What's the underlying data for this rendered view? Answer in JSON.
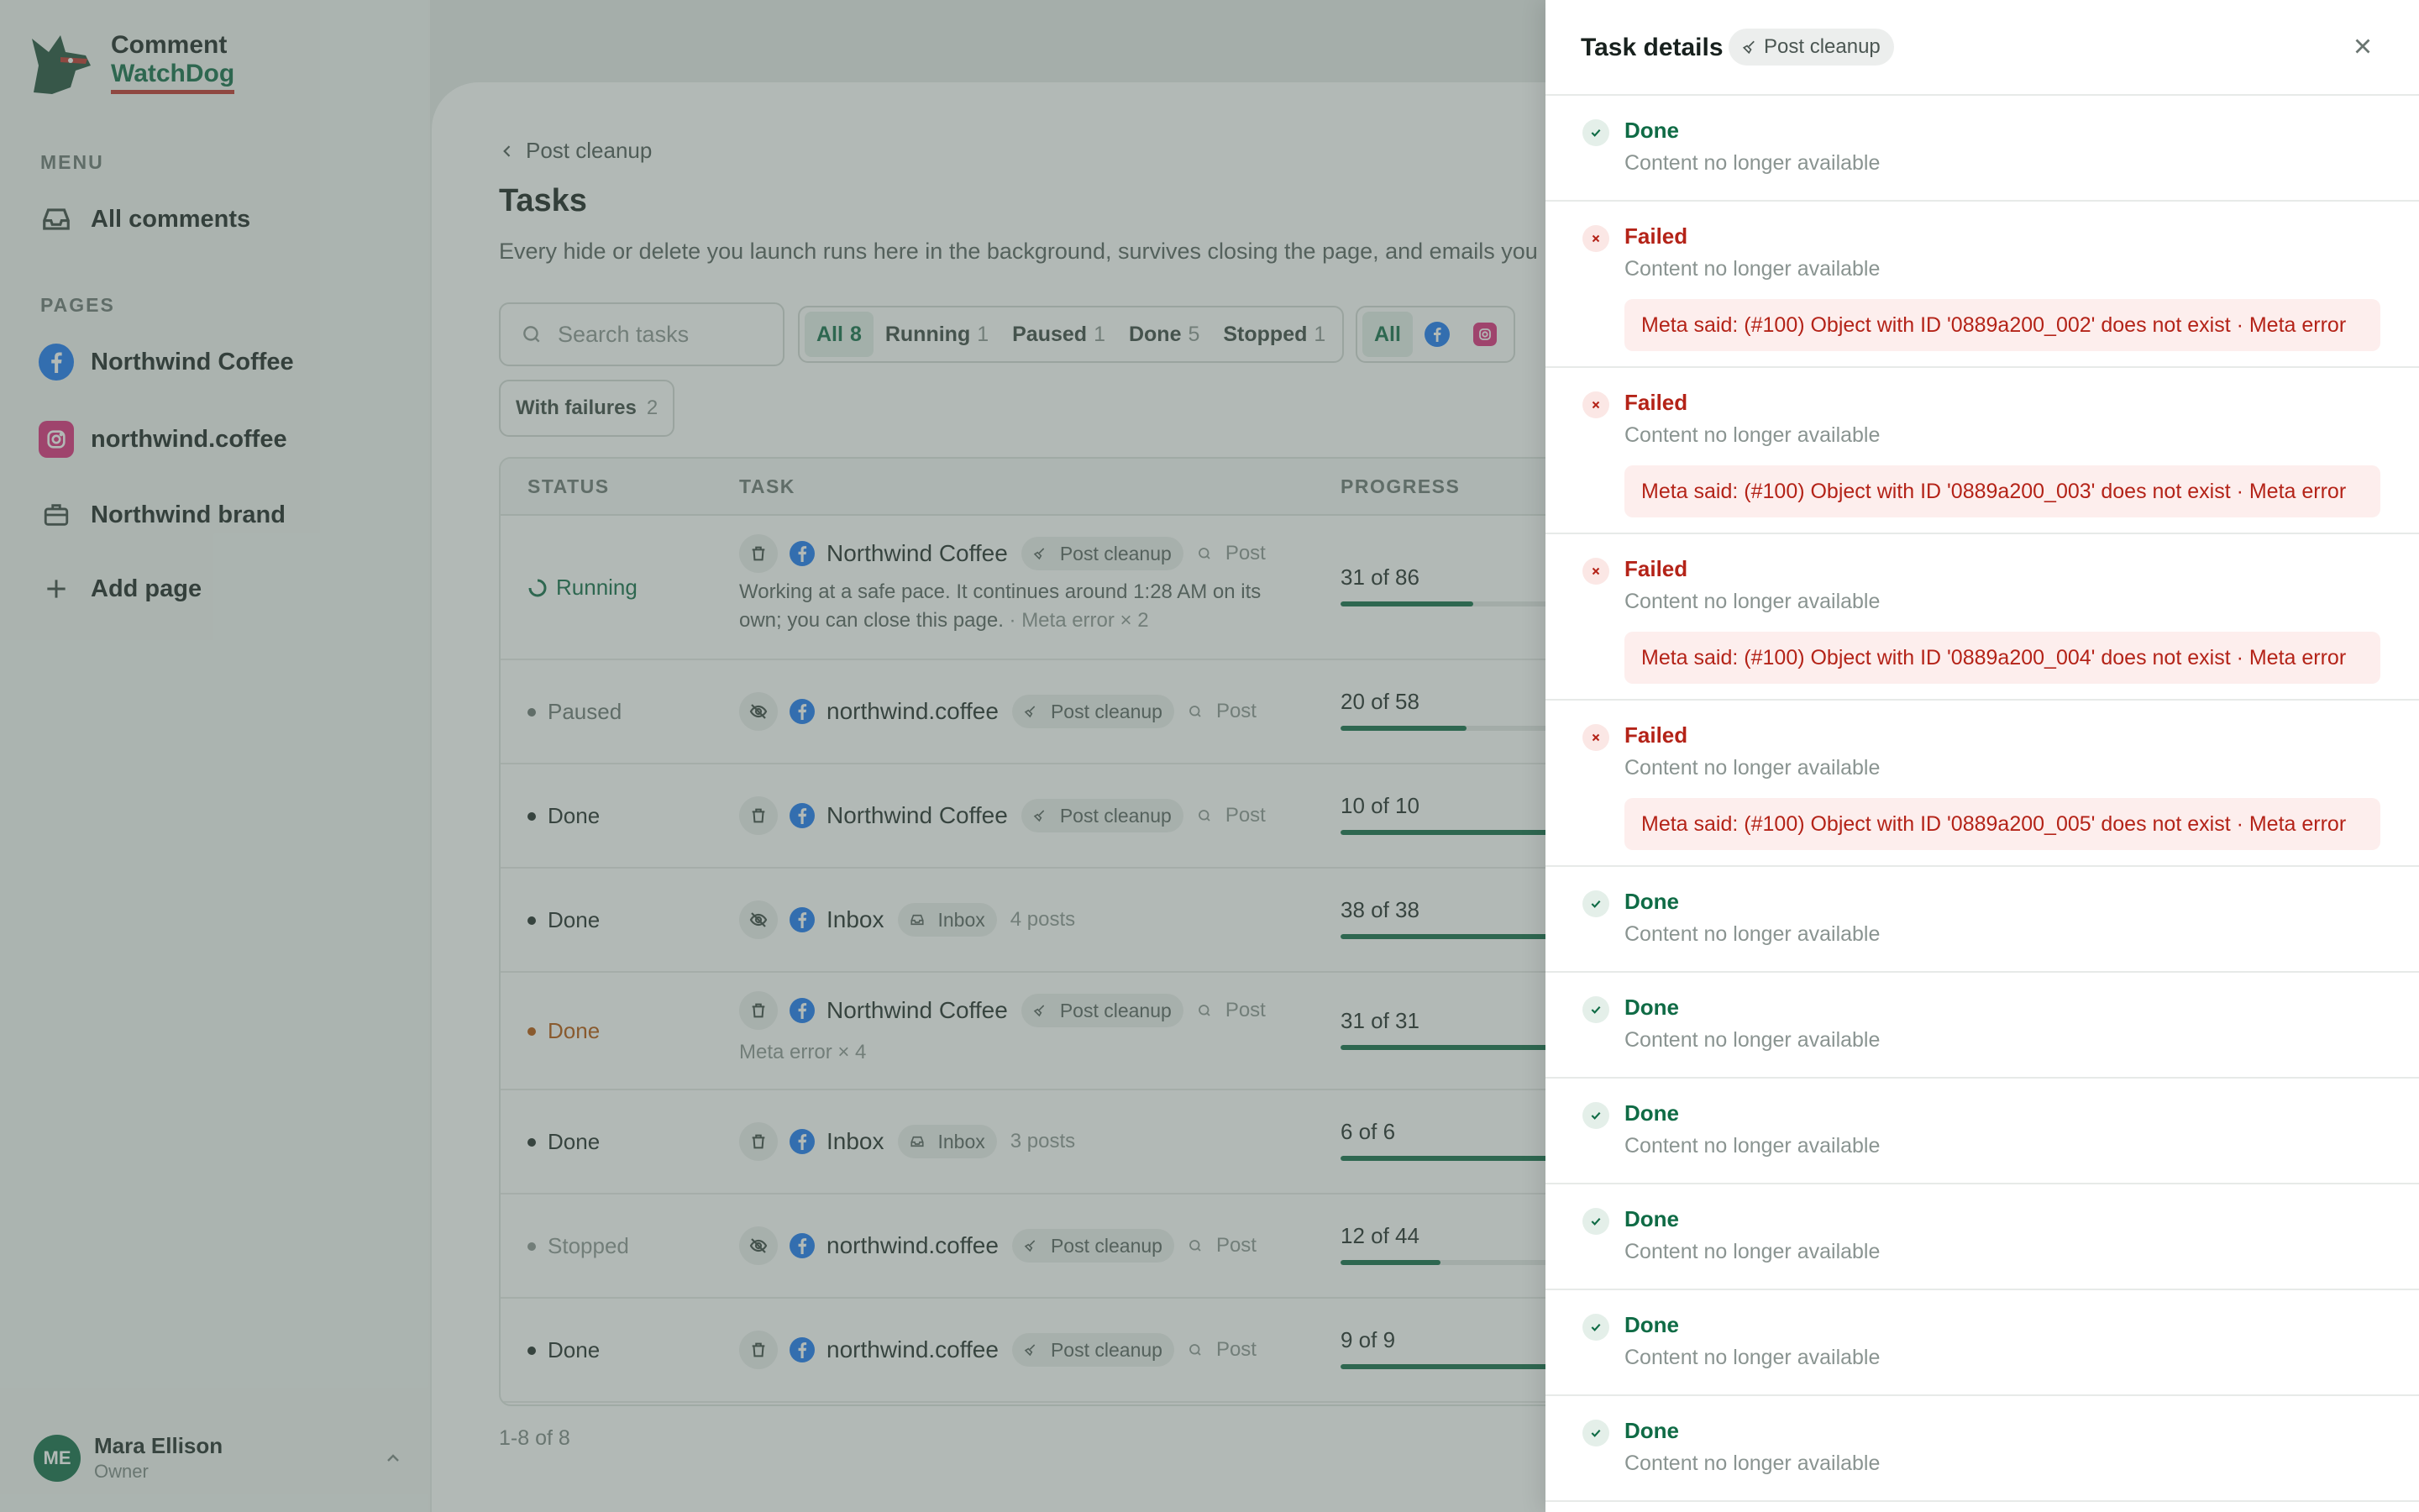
{
  "brand": {
    "line1": "Comment",
    "line2": "WatchDog"
  },
  "sidebar": {
    "menu_label": "MENU",
    "menu_items": [
      {
        "label": "All comments",
        "icon": "inbox-icon"
      }
    ],
    "pages_label": "PAGES",
    "pages": [
      {
        "label": "Northwind Coffee",
        "icon": "facebook-icon"
      },
      {
        "label": "northwind.coffee",
        "icon": "instagram-icon"
      },
      {
        "label": "Northwind brand",
        "icon": "briefcase-icon"
      }
    ],
    "add_page": "Add page",
    "user": {
      "initials": "ME",
      "name": "Mara Ellison",
      "role": "Owner"
    }
  },
  "main": {
    "back_label": "Post cleanup",
    "title": "Tasks",
    "subtitle": "Every hide or delete you launch runs here in the background, survives closing the page, and emails you",
    "search_placeholder": "Search tasks",
    "status_filters": [
      {
        "label": "All",
        "count": "8"
      },
      {
        "label": "Running",
        "count": "1"
      },
      {
        "label": "Paused",
        "count": "1"
      },
      {
        "label": "Done",
        "count": "5"
      },
      {
        "label": "Stopped",
        "count": "1"
      }
    ],
    "platform_filters": [
      {
        "label": "All"
      }
    ],
    "failures_filter": {
      "label": "With failures",
      "count": "2"
    },
    "columns": {
      "status": "STATUS",
      "task": "TASK",
      "progress": "PROGRESS"
    },
    "rows": [
      {
        "status": "Running",
        "status_color": "#0f6b45",
        "action": "delete",
        "page": "Northwind Coffee",
        "tag": "Post cleanup",
        "scope": "Post",
        "desc": "Working at a safe pace. It continues around 1:28 AM on its own; you can close this page.",
        "desc_muted": " · Meta error × 2",
        "progress": "31 of 86",
        "fraction": 0.36
      },
      {
        "status": "Paused",
        "status_color": "#6a7571",
        "action": "hide",
        "page": "northwind.coffee",
        "tag": "Post cleanup",
        "scope": "Post",
        "progress": "20 of 58",
        "fraction": 0.34
      },
      {
        "status": "Done",
        "status_color": "#1f2a27",
        "action": "delete",
        "page": "Northwind Coffee",
        "tag": "Post cleanup",
        "scope": "Post",
        "progress": "10 of 10",
        "fraction": 1.0
      },
      {
        "status": "Done",
        "status_color": "#1f2a27",
        "action": "hide",
        "page": "Inbox",
        "tag": "Inbox",
        "scope": "4 posts",
        "progress": "38 of 38",
        "fraction": 1.0
      },
      {
        "status": "Done",
        "status_color": "#b45309",
        "action": "delete",
        "page": "Northwind Coffee",
        "tag": "Post cleanup",
        "scope": "Post",
        "desc_muted": "Meta error × 4",
        "progress": "31 of 31",
        "fraction": 1.0
      },
      {
        "status": "Done",
        "status_color": "#1f2a27",
        "action": "delete",
        "page": "Inbox",
        "tag": "Inbox",
        "scope": "3 posts",
        "progress": "6 of 6",
        "fraction": 1.0
      },
      {
        "status": "Stopped",
        "status_color": "#8a9491",
        "action": "hide",
        "page": "northwind.coffee",
        "tag": "Post cleanup",
        "scope": "Post",
        "progress": "12 of 44",
        "fraction": 0.27
      },
      {
        "status": "Done",
        "status_color": "#1f2a27",
        "action": "delete",
        "page": "northwind.coffee",
        "tag": "Post cleanup",
        "scope": "Post",
        "progress": "9 of 9",
        "fraction": 1.0
      }
    ],
    "count_label": "1-8 of 8"
  },
  "drawer": {
    "title": "Task details",
    "tag": "Post cleanup",
    "items": [
      {
        "status": "Done",
        "desc": "Content no longer available"
      },
      {
        "status": "Failed",
        "desc": "Content no longer available",
        "error": "Meta said: (#100) Object with ID '0889a200_002' does not exist · Meta error"
      },
      {
        "status": "Failed",
        "desc": "Content no longer available",
        "error": "Meta said: (#100) Object with ID '0889a200_003' does not exist · Meta error"
      },
      {
        "status": "Failed",
        "desc": "Content no longer available",
        "error": "Meta said: (#100) Object with ID '0889a200_004' does not exist · Meta error"
      },
      {
        "status": "Failed",
        "desc": "Content no longer available",
        "error": "Meta said: (#100) Object with ID '0889a200_005' does not exist · Meta error"
      },
      {
        "status": "Done",
        "desc": "Content no longer available"
      },
      {
        "status": "Done",
        "desc": "Content no longer available"
      },
      {
        "status": "Done",
        "desc": "Content no longer available"
      },
      {
        "status": "Done",
        "desc": "Content no longer available"
      },
      {
        "status": "Done",
        "desc": "Content no longer available"
      },
      {
        "status": "Done",
        "desc": "Content no longer available"
      }
    ]
  },
  "colors": {
    "accent": "#0f6b45",
    "danger": "#b42318",
    "facebook": "#1877f2",
    "instagram": "#dd2a7b"
  }
}
